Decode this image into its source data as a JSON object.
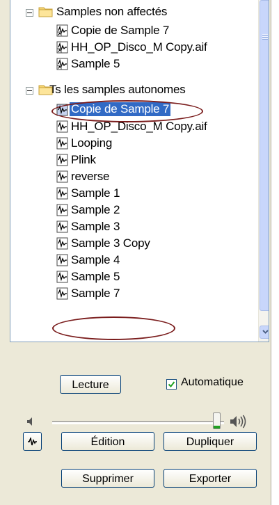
{
  "tree": {
    "groups": [
      {
        "label": "Samples non affectés",
        "items": [
          "Copie de Sample 7",
          "HH_OP_Disco_M Copy.aif",
          "Sample 5"
        ]
      },
      {
        "label": "Ts les samples autonomes",
        "items": [
          "Copie de Sample 7",
          "HH_OP_Disco_M Copy.aif",
          "Looping",
          "Plink",
          "reverse",
          "Sample 1",
          "Sample 2",
          "Sample 3",
          "Sample 3 Copy",
          "Sample 4",
          "Sample 5",
          "Sample 7"
        ]
      }
    ],
    "selected": "Copie de Sample 7"
  },
  "controls": {
    "play_label": "Lecture",
    "auto_label": "Automatique",
    "auto_checked": true,
    "volume_fraction": 0.94,
    "edit_label": "Édition",
    "duplicate_label": "Dupliquer",
    "delete_label": "Supprimer",
    "export_label": "Exporter"
  },
  "colors": {
    "selection": "#316ac5",
    "highlight_ellipse": "#7a1c1c",
    "panel": "#ece9d8"
  }
}
